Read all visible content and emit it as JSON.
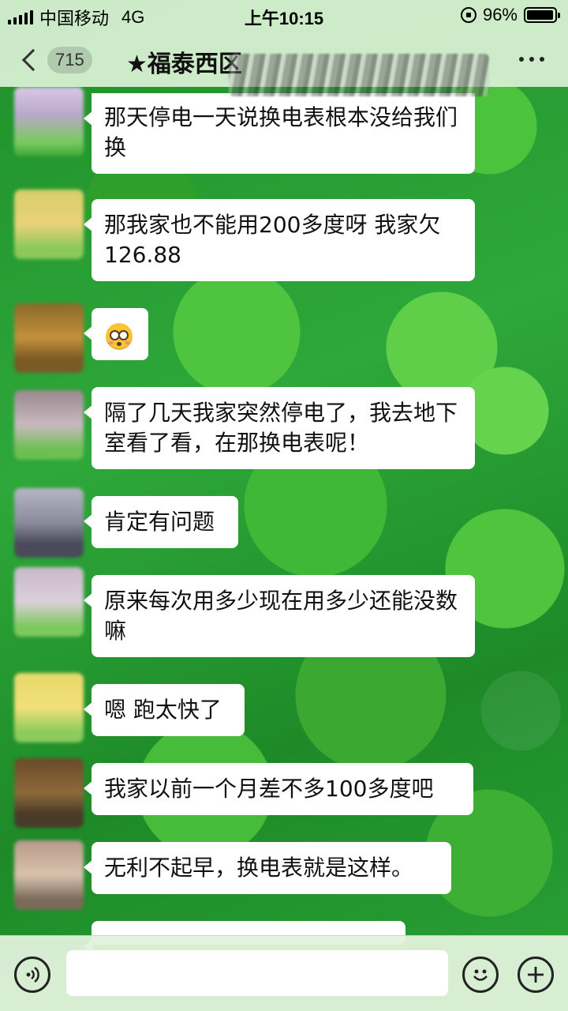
{
  "status_bar": {
    "carrier": "中国移动",
    "network": "4G",
    "time": "上午10:15",
    "battery": "96%",
    "battery_level": 0.96
  },
  "nav": {
    "unread_count": "715",
    "title": "★福泰西区"
  },
  "messages": [
    {
      "text": "那天停电一天说换电表根本没给我们换"
    },
    {
      "text": "那我家也不能用200多度呀 我家欠126.88"
    },
    {
      "text": "",
      "emoji": "flushed-face-emoji"
    },
    {
      "text": "隔了几天我家突然停电了，我去地下室看了看，在那换电表呢！"
    },
    {
      "text": "肯定有问题"
    },
    {
      "text": "原来每次用多少现在用多少还能没数嘛"
    },
    {
      "text": "嗯 跑太快了"
    },
    {
      "text": "我家以前一个月差不多100多度吧"
    },
    {
      "text": "无利不起早，换电表就是这样。"
    },
    {
      "text": ""
    }
  ],
  "input": {
    "placeholder": ""
  },
  "icons": {
    "voice": "voice-icon",
    "emoji": "emoji-icon",
    "add": "plus-icon"
  }
}
